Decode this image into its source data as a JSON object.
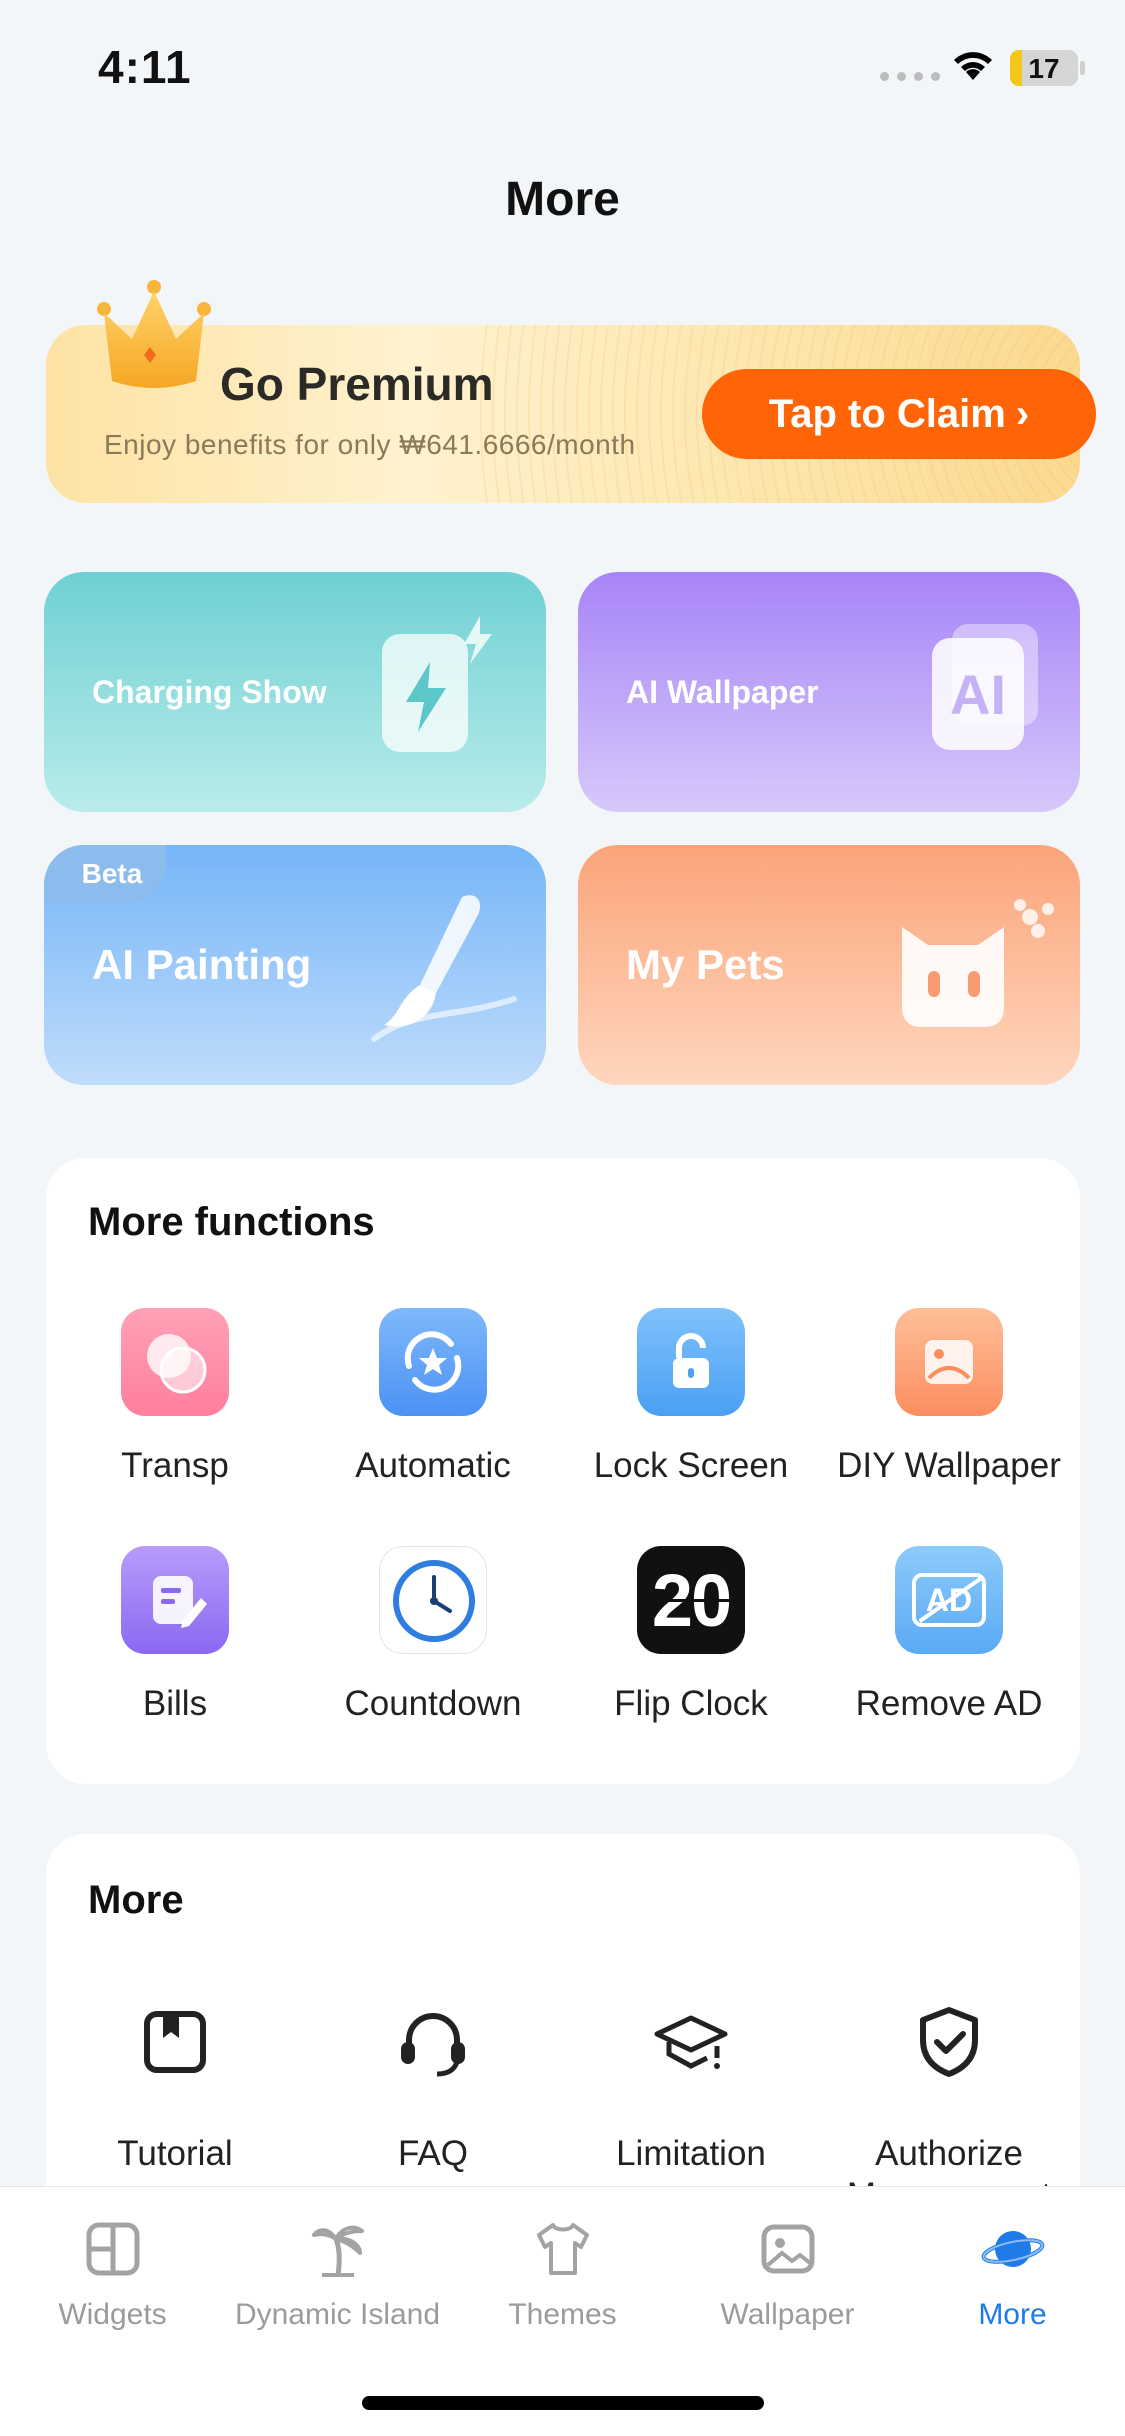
{
  "status_bar": {
    "time": "4:11",
    "battery": "17"
  },
  "page_title": "More",
  "premium": {
    "title": "Go Premium",
    "subtitle": "Enjoy benefits for only ₩641.6666/month",
    "claim_label": "Tap to Claim",
    "accent": "#ff6406"
  },
  "feature_cards": [
    {
      "label": "Charging Show"
    },
    {
      "label": "AI Wallpaper"
    },
    {
      "label": "AI Painting",
      "badge": "Beta"
    },
    {
      "label": "My Pets"
    }
  ],
  "functions": {
    "title": "More functions",
    "items": [
      {
        "label": "Transp",
        "icon": "overlapping-circles-icon"
      },
      {
        "label": "Automatic",
        "icon": "rotate-star-icon"
      },
      {
        "label": "Lock Screen",
        "icon": "unlock-icon"
      },
      {
        "label": "DIY Wallpaper",
        "icon": "picture-icon"
      },
      {
        "label": "Bills",
        "icon": "document-edit-icon"
      },
      {
        "label": "Countdown",
        "icon": "clock-icon"
      },
      {
        "label": "Flip Clock",
        "icon": "flip-clock-icon",
        "icon_text": "20"
      },
      {
        "label": "Remove AD",
        "icon": "remove-ad-icon",
        "icon_text": "AD"
      }
    ]
  },
  "more": {
    "title": "More",
    "items": [
      {
        "label": "Tutorial",
        "icon": "book-icon"
      },
      {
        "label": "FAQ",
        "icon": "headset-icon"
      },
      {
        "label": "Limitation",
        "icon": "graduation-cap-icon"
      },
      {
        "label": "Authorize Management",
        "icon": "shield-check-icon"
      }
    ]
  },
  "tabs": [
    {
      "label": "Widgets",
      "icon": "widgets-icon"
    },
    {
      "label": "Dynamic Island",
      "icon": "palm-tree-icon"
    },
    {
      "label": "Themes",
      "icon": "tshirt-icon"
    },
    {
      "label": "Wallpaper",
      "icon": "picture-icon"
    },
    {
      "label": "More",
      "icon": "planet-icon",
      "active": true
    }
  ],
  "colors": {
    "active_tab": "#1e7be8",
    "background": "#f3f6f8"
  }
}
